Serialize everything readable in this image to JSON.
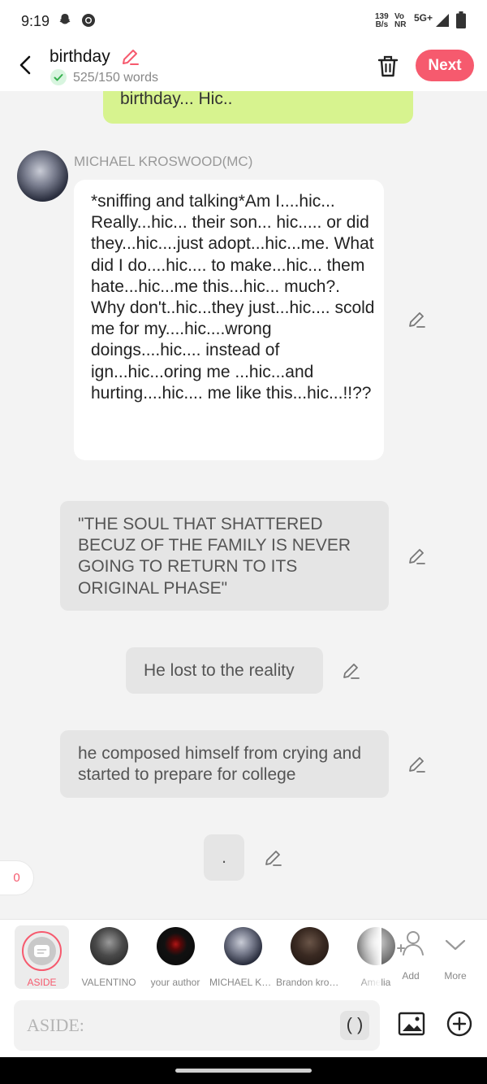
{
  "status_bar": {
    "time": "9:19",
    "net_speed_top": "139",
    "net_speed_bottom": "B/s",
    "volte_top": "Vo",
    "volte_bottom": "NR",
    "network": "5G+"
  },
  "header": {
    "title": "birthday",
    "word_count": "525/150 words",
    "next_label": "Next",
    "accent_color": "#f65a6e"
  },
  "messages": {
    "prev_bubble_text": "birthday... Hic..",
    "character_name": "MICHAEL KROSWOOD(MC)",
    "character_message": "*sniffing and talking*Am I....hic... Really...hic... their son... hic..... or did they...hic....just adopt...hic...me. What did I do....hic.... to make...hic... them hate...hic...me this...hic... much?. Why don't..hic...they just...hic.... scold me for my....hic....wrong doings....hic.... instead of ign...hic...oring me ...hic...and hurting....hic.... me like this...hic...!!??",
    "aside_1": "\"THE SOUL THAT SHATTERED BECUZ OF THE FAMILY IS NEVER GOING TO RETURN TO ITS ORIGINAL PHASE\"",
    "aside_2": "He lost to the reality",
    "aside_3": "he composed himself from crying and started to prepare for college",
    "aside_4": ".",
    "counter": "0"
  },
  "character_bar": {
    "items": [
      {
        "label": "ASIDE"
      },
      {
        "label": "VALENTINO"
      },
      {
        "label": "your author"
      },
      {
        "label": "MICHAEL KROSWOOD"
      },
      {
        "label": "Brandon kroswood"
      },
      {
        "label": "Amelia"
      }
    ],
    "add_label": "Add",
    "more_label": "More"
  },
  "input": {
    "placeholder": "ASIDE:",
    "paren_label": "( )"
  }
}
